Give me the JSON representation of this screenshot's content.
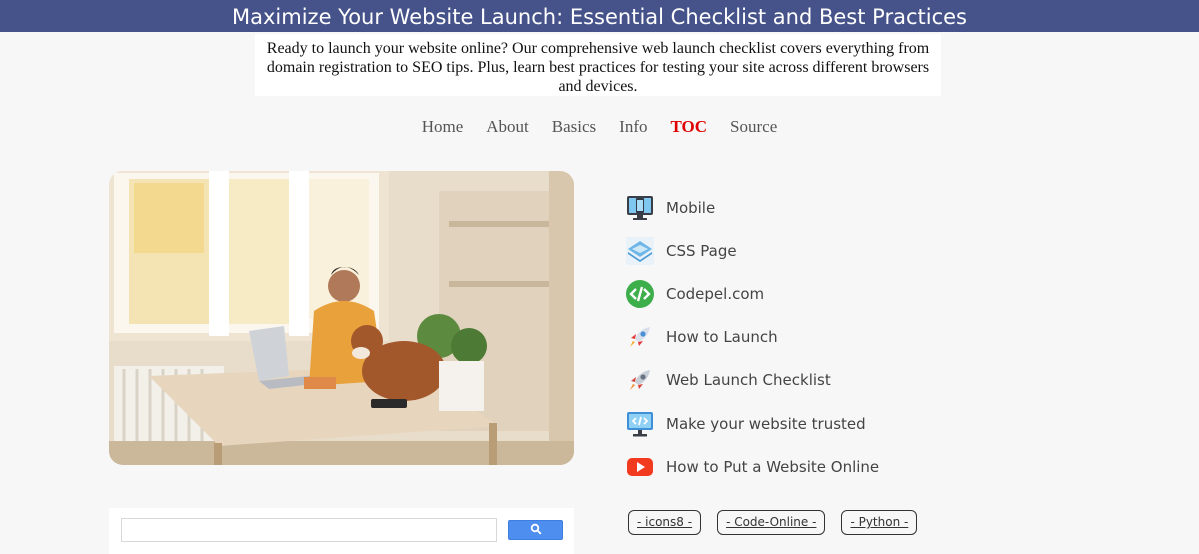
{
  "header": {
    "title": "Maximize Your Website Launch: Essential Checklist and Best Practices"
  },
  "intro": {
    "text": "Ready to launch your website online? Our comprehensive web launch checklist covers everything from domain registration to SEO tips. Plus, learn best practices for testing your site across different browsers and devices."
  },
  "nav": {
    "items": [
      {
        "label": "Home"
      },
      {
        "label": "About"
      },
      {
        "label": "Basics"
      },
      {
        "label": "Info"
      },
      {
        "label": "TOC",
        "active": true
      },
      {
        "label": "Source"
      }
    ]
  },
  "links": {
    "items": [
      {
        "label": "Mobile",
        "icon": "mobile-monitor-icon"
      },
      {
        "label": "CSS Page",
        "icon": "css-page-icon"
      },
      {
        "label": "Codepel.com",
        "icon": "code-tag-icon"
      },
      {
        "label": "How to Launch",
        "icon": "rocket-icon"
      },
      {
        "label": "Web Launch Checklist",
        "icon": "rocket-icon"
      },
      {
        "label": "Make your website trusted",
        "icon": "code-monitor-icon"
      },
      {
        "label": "How to Put a Website Online",
        "icon": "youtube-play-icon"
      }
    ]
  },
  "search": {
    "value": "",
    "button_icon": "search-icon"
  },
  "tags": {
    "items": [
      {
        "label": "- icons8 -"
      },
      {
        "label": "- Code-Online -"
      },
      {
        "label": "- Python -"
      }
    ]
  },
  "colors": {
    "banner": "#46538a",
    "active_nav": "#e00000",
    "search_button": "#4d8eef"
  }
}
